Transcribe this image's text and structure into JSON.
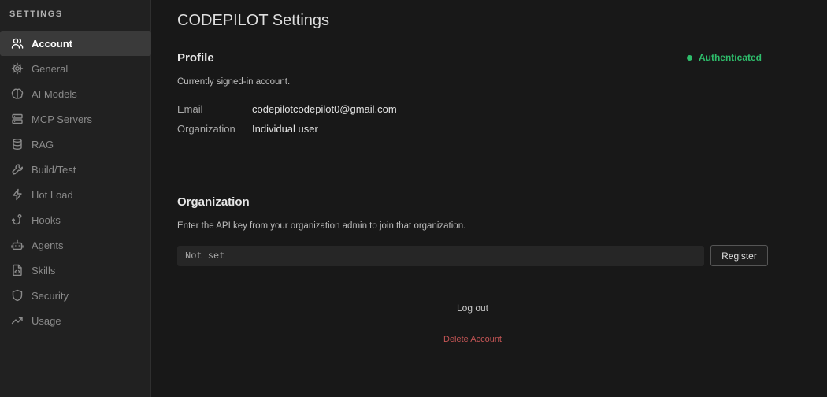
{
  "sidebar": {
    "heading": "SETTINGS",
    "items": [
      {
        "label": "Account",
        "icon": "users-icon",
        "active": true
      },
      {
        "label": "General",
        "icon": "gear-icon"
      },
      {
        "label": "AI Models",
        "icon": "brain-icon"
      },
      {
        "label": "MCP Servers",
        "icon": "server-icon"
      },
      {
        "label": "RAG",
        "icon": "database-icon"
      },
      {
        "label": "Build/Test",
        "icon": "wrench-icon"
      },
      {
        "label": "Hot Load",
        "icon": "lightning-icon"
      },
      {
        "label": "Hooks",
        "icon": "hook-icon"
      },
      {
        "label": "Agents",
        "icon": "robot-icon"
      },
      {
        "label": "Skills",
        "icon": "file-code-icon"
      },
      {
        "label": "Security",
        "icon": "shield-icon"
      },
      {
        "label": "Usage",
        "icon": "trend-icon"
      }
    ]
  },
  "main": {
    "title": "CODEPILOT Settings",
    "profile": {
      "title": "Profile",
      "status": "Authenticated",
      "status_color": "#2ebd6b",
      "description": "Currently signed-in account.",
      "email_label": "Email",
      "email_value": "codepilotcodepilot0@gmail.com",
      "org_label": "Organization",
      "org_value": "Individual user"
    },
    "organization": {
      "title": "Organization",
      "description": "Enter the API key from your organization admin to join that organization.",
      "api_key_placeholder": "Not set",
      "register_label": "Register"
    },
    "logout_label": "Log out",
    "delete_label": "Delete Account",
    "delete_color": "#c45555"
  }
}
